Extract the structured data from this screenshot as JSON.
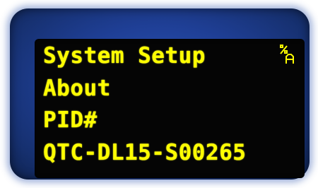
{
  "display": {
    "lines": [
      "System Setup",
      "About",
      "PID#",
      "QTC-DL15-S00265"
    ],
    "mode_indicator_icon": "percent-a-icon",
    "text_color": "#ffff00",
    "screen_color": "#050505",
    "bezel_color": "#1f3f96"
  }
}
